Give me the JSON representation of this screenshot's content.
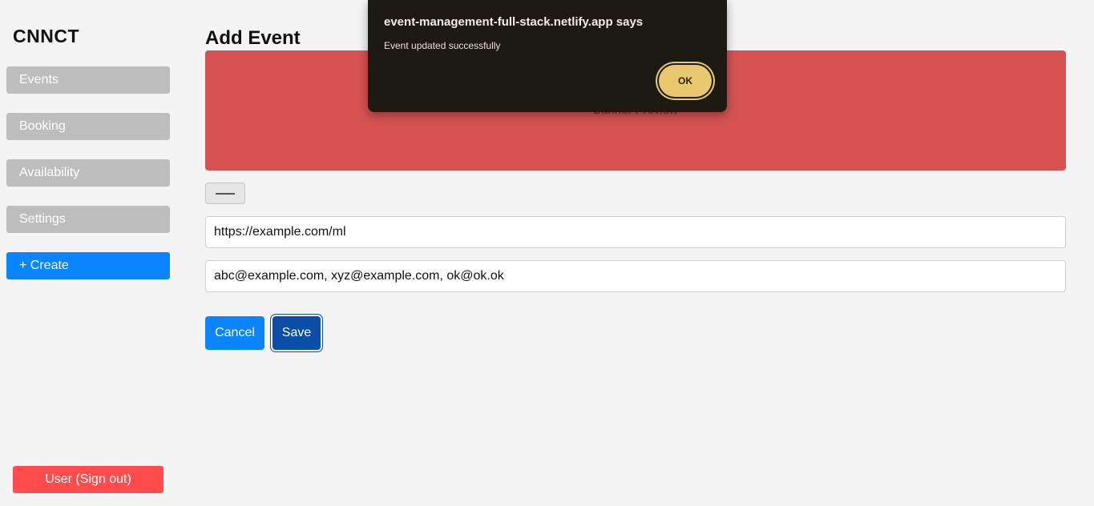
{
  "sidebar": {
    "brand": "CNNCT",
    "items": [
      {
        "label": "Events"
      },
      {
        "label": "Booking"
      },
      {
        "label": "Availability"
      },
      {
        "label": "Settings"
      }
    ],
    "create_label": "+ Create",
    "signout_label": "User (Sign out)"
  },
  "main": {
    "title": "Add Event",
    "banner_label": "Banner Preview",
    "link_value": "https://example.com/ml",
    "emails_value": "abc@example.com, xyz@example.com, ok@ok.ok",
    "cancel_label": "Cancel",
    "save_label": "Save"
  },
  "dialog": {
    "title": "event-management-full-stack.netlify.app says",
    "message": "Event updated successfully",
    "ok_label": "OK"
  },
  "colors": {
    "accent": "#0a84ff",
    "banner": "#d65252",
    "signout": "#ff4c4c",
    "dialog_bg": "#1d1a14",
    "dialog_button": "#e8c76d"
  }
}
